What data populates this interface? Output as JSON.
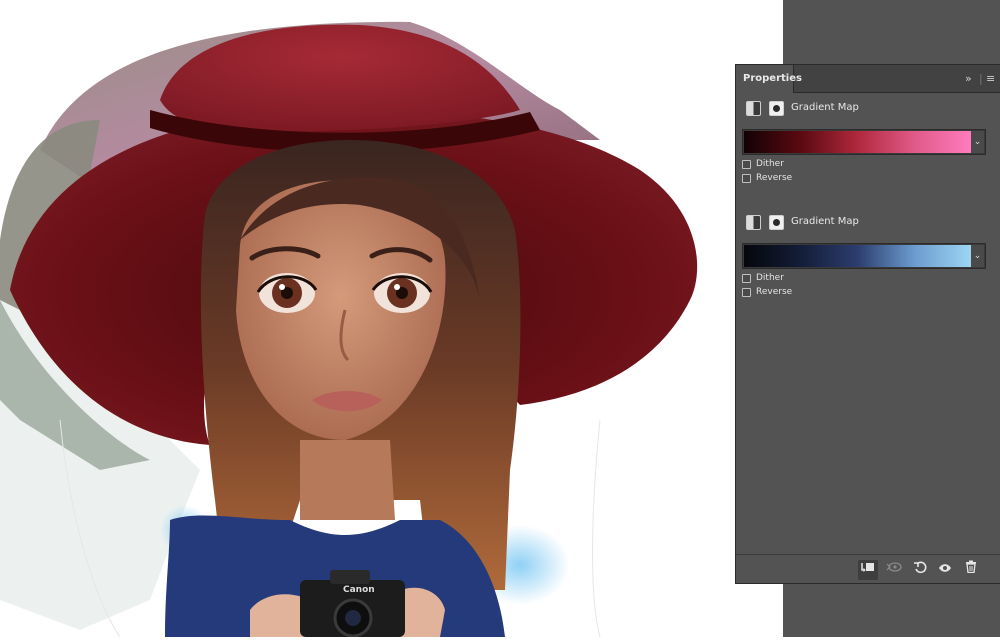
{
  "panel": {
    "tab_label": "Properties",
    "collapse_glyph": "»",
    "menu_glyph": "≡",
    "adjustments": [
      {
        "title": "Gradient Map",
        "gradient_colors": [
          "#120205",
          "#5a0a10",
          "#b0283c",
          "#e05a88",
          "#ff7bbd"
        ],
        "dither_label": "Dither",
        "reverse_label": "Reverse"
      },
      {
        "title": "Gradient Map",
        "gradient_colors": [
          "#05070c",
          "#141d38",
          "#2c3d6e",
          "#6c9bcf",
          "#9dd5f3"
        ],
        "dither_label": "Dither",
        "reverse_label": "Reverse"
      }
    ],
    "dropdown_glyph": "⌄"
  },
  "footer": {
    "clip_icon": "clip-to-layer-icon",
    "view_previous_icon": "view-previous-state-icon",
    "reset_icon": "reset-icon",
    "visibility_icon": "eye-icon",
    "delete_icon": "trash-icon"
  }
}
